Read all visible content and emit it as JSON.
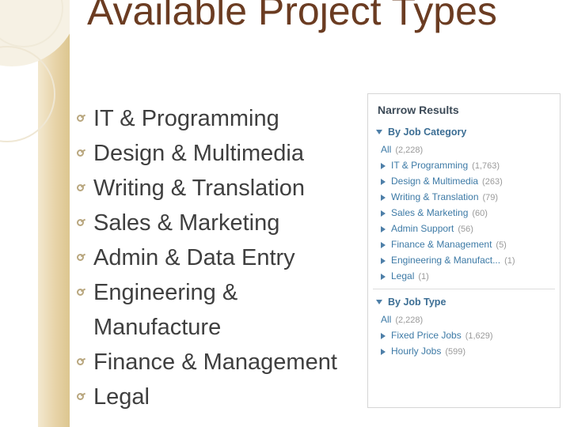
{
  "slide": {
    "title": "Available Project Types",
    "bullets": [
      "IT & Programming",
      "Design & Multimedia",
      "Writing & Translation",
      "Sales & Marketing",
      "Admin & Data Entry",
      "Engineering & Manufacture",
      "Finance & Management",
      "Legal"
    ]
  },
  "panel": {
    "header": "Narrow Results",
    "groups": [
      {
        "label": "By Job Category",
        "all_label": "All",
        "all_count": "(2,228)",
        "items": [
          {
            "label": "IT & Programming",
            "count": "(1,763)"
          },
          {
            "label": "Design & Multimedia",
            "count": "(263)"
          },
          {
            "label": "Writing & Translation",
            "count": "(79)"
          },
          {
            "label": "Sales & Marketing",
            "count": "(60)"
          },
          {
            "label": "Admin Support",
            "count": "(56)"
          },
          {
            "label": "Finance & Management",
            "count": "(5)"
          },
          {
            "label": "Engineering & Manufact...",
            "count": "(1)"
          },
          {
            "label": "Legal",
            "count": "(1)"
          }
        ]
      },
      {
        "label": "By Job Type",
        "all_label": "All",
        "all_count": "(2,228)",
        "items": [
          {
            "label": "Fixed Price Jobs",
            "count": "(1,629)"
          },
          {
            "label": "Hourly Jobs",
            "count": "(599)"
          }
        ]
      }
    ]
  },
  "colors": {
    "title": "#6b3c22",
    "bullet_text": "#3f3f3f",
    "bullet_marker": "#b9a77f",
    "panel_link": "#3d7aa6",
    "panel_count": "#9a9a9a",
    "band": "#e7d3a8"
  }
}
